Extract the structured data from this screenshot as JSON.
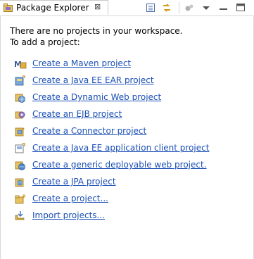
{
  "tab": {
    "title": "Package Explorer",
    "close_glyph": "⊠"
  },
  "toolbar": {
    "icons": [
      "collapse-all-icon",
      "link-with-editor-icon",
      "focus-icon",
      "view-menu-icon",
      "minimize-icon",
      "maximize-icon"
    ]
  },
  "message": {
    "line1": "There are no projects in your workspace.",
    "line2": "To add a project:"
  },
  "links": [
    {
      "label": "Create a Maven project",
      "icon": "maven-project-icon"
    },
    {
      "label": "Create a Java EE EAR project",
      "icon": "ear-project-icon"
    },
    {
      "label": "Create a Dynamic Web project",
      "icon": "dynamic-web-project-icon"
    },
    {
      "label": "Create an EJB project",
      "icon": "ejb-project-icon"
    },
    {
      "label": "Create a Connector project",
      "icon": "connector-project-icon"
    },
    {
      "label": "Create a Java EE application client project",
      "icon": "app-client-project-icon"
    },
    {
      "label": "Create a generic deployable web project.",
      "icon": "generic-web-project-icon"
    },
    {
      "label": "Create a JPA project",
      "icon": "jpa-project-icon"
    },
    {
      "label": "Create a project...",
      "icon": "new-project-icon"
    },
    {
      "label": "Import projects...",
      "icon": "import-projects-icon"
    }
  ]
}
